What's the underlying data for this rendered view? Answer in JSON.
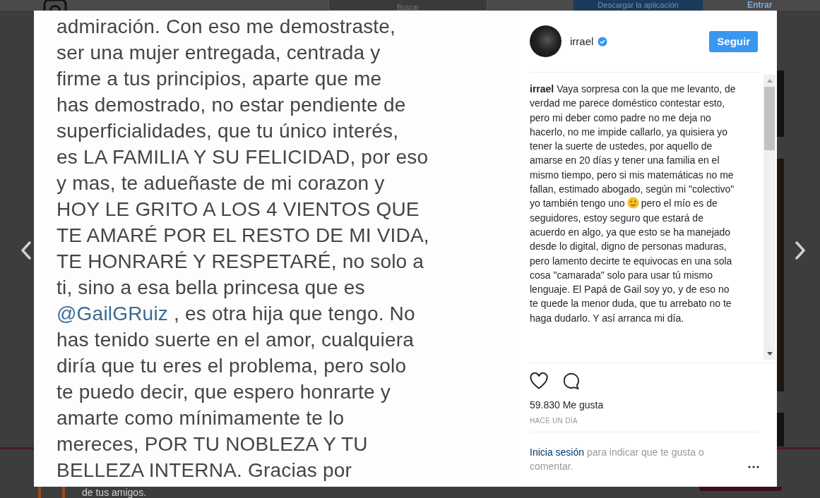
{
  "page_behind": {
    "search_placeholder": "Buscar",
    "download_button": "Descargar la aplicación",
    "login_link": "Entrar",
    "banner_text": "de tus amigos."
  },
  "post_image": {
    "lines": [
      {
        "text": "admiración.  Con eso me demostraste,"
      },
      {
        "text": "ser una mujer entregada, centrada y"
      },
      {
        "text": "firme a tus principios, aparte que me"
      },
      {
        "text": "has demostrado, no estar pendiente de"
      },
      {
        "text": "superficialidades, que tu único interés,"
      },
      {
        "text": "es LA FAMILIA Y SU FELICIDAD, por eso"
      },
      {
        "text": "y mas, te adueñaste de mi corazon y"
      },
      {
        "text": "HOY LE GRITO A LOS 4 VIENTOS QUE"
      },
      {
        "text": "TE AMARÉ POR EL RESTO DE MI VIDA,"
      },
      {
        "text": "TE HONRARÉ Y RESPETARÉ, no solo a"
      },
      {
        "text": "ti, sino a esa bella princesa que es"
      },
      {
        "mention": "@GailGRuiz",
        "text": " , es otra hija que tengo.  No"
      },
      {
        "text": "has tenido suerte en el amor, cualquiera"
      },
      {
        "text": "diría que tu eres el problema, pero solo"
      },
      {
        "text": "te puedo decir, que espero honrarte y"
      },
      {
        "text": "amarte como mínimamente te lo"
      },
      {
        "text": "mereces, POR TU NOBLEZA Y TU"
      },
      {
        "text": "BELLEZA INTERNA.  Gracias por"
      }
    ]
  },
  "author": {
    "username": "irrael",
    "verified": true
  },
  "follow_button": "Seguir",
  "caption": {
    "text_before": "**irrael** Vaya sorpresa con la que me levanto, de verdad me parece doméstico contestar esto, pero mi deber como padre no me deja no hacerlo, no me impide callarlo, ya quisiera yo tener la suerte de ustedes, por aquello de amarse en 20 días y tener una familia en el mismo tiempo, pero si mis matemáticas no me fallan, estimado abogado, según mi \"colectivo\" yo también tengo uno",
    "text_after": "pero el mío es de seguidores, estoy seguro que estará de acuerdo en algo, ya que esto se ha manejado desde lo digital, digno de personas maduras, pero lamento decirte te equivocas en una sola cosa \"camarada\" solo para usar tú mismo lenguaje. El Papá de Gail soy yo, y de eso no te quede la menor duda, que tu arrebato no te haga dudarlo. Y así arranca mi día."
  },
  "likes": "59.830 Me gusta",
  "time": "HACE UN DÍA",
  "login_prompt": {
    "link": "Inicia sesión",
    "text": "para indicar que te gusta o comentar."
  }
}
